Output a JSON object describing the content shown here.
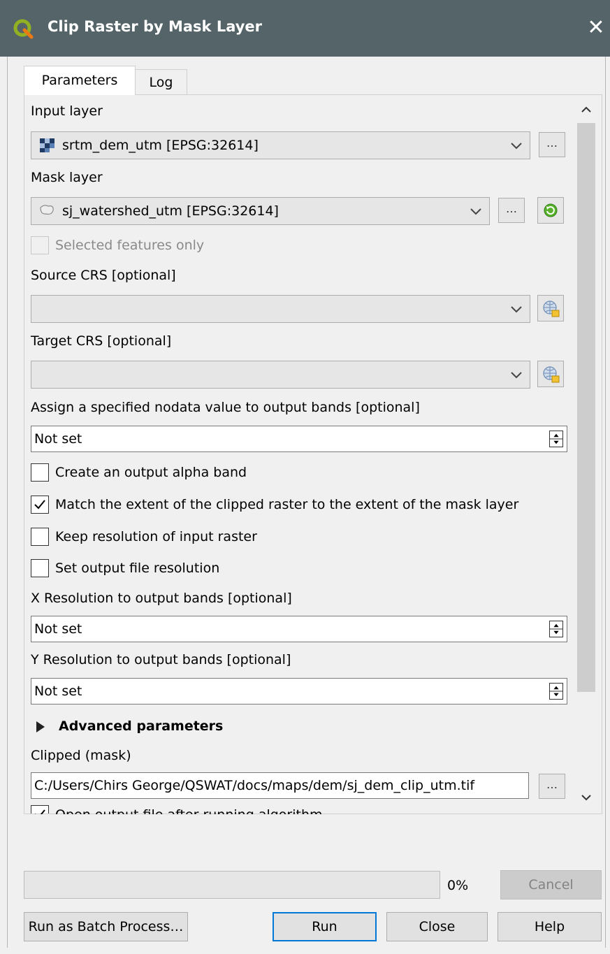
{
  "window": {
    "title": "Clip Raster by Mask Layer",
    "close_glyph": "✕"
  },
  "tabs": [
    {
      "label": "Parameters",
      "active": true
    },
    {
      "label": "Log",
      "active": false
    }
  ],
  "form": {
    "input_layer": {
      "label": "Input layer",
      "value": "srtm_dem_utm [EPSG:32614]",
      "browse": "…"
    },
    "mask_layer": {
      "label": "Mask layer",
      "value": "sj_watershed_utm [EPSG:32614]",
      "browse": "…"
    },
    "selected_only": {
      "label": "Selected features only",
      "checked": false,
      "enabled": false
    },
    "source_crs": {
      "label": "Source CRS [optional]",
      "value": ""
    },
    "target_crs": {
      "label": "Target CRS [optional]",
      "value": ""
    },
    "nodata": {
      "label": "Assign a specified nodata value to output bands [optional]",
      "value": "Not set"
    },
    "alpha_band": {
      "label": "Create an output alpha band",
      "checked": false
    },
    "match_extent": {
      "label": "Match the extent of the clipped raster to the extent of the mask layer",
      "checked": true
    },
    "keep_resolution": {
      "label": "Keep resolution of input raster",
      "checked": false
    },
    "set_resolution": {
      "label": "Set output file resolution",
      "checked": false
    },
    "x_res": {
      "label": "X Resolution to output bands [optional]",
      "value": "Not set"
    },
    "y_res": {
      "label": "Y Resolution to output bands [optional]",
      "value": "Not set"
    },
    "advanced": {
      "label": "Advanced parameters"
    },
    "output": {
      "label": "Clipped (mask)",
      "value": "C:/Users/Chirs George/QSWAT/docs/maps/dem/sj_dem_clip_utm.tif",
      "browse": "…"
    },
    "open_output": {
      "label": "Open output file after running algorithm",
      "checked": true
    }
  },
  "footer": {
    "progress_percent": "0%",
    "progress_value": 0,
    "cancel": "Cancel",
    "batch": "Run as Batch Process…",
    "run": "Run",
    "close": "Close",
    "help": "Help"
  },
  "icons": {
    "app": "qgis-logo-icon",
    "raster": "raster-layer-icon",
    "polygon": "polygon-layer-icon",
    "iterate": "iterate-icon",
    "crs": "crs-selector-icon"
  }
}
